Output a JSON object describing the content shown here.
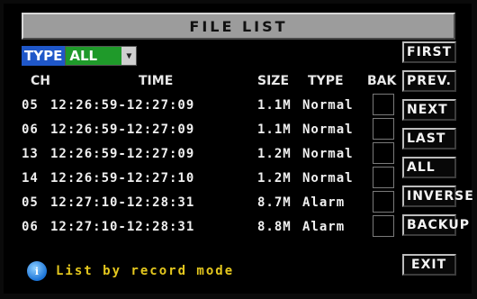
{
  "title": "FILE LIST",
  "type_filter": {
    "label": "TYPE",
    "value": "ALL"
  },
  "table": {
    "headers": {
      "ch": "CH",
      "time": "TIME",
      "size": "SIZE",
      "type": "TYPE",
      "bak": "BAK"
    },
    "rows": [
      {
        "ch": "05",
        "time": "12:26:59-12:27:09",
        "size": "1.1M",
        "type": "Normal",
        "bak": false
      },
      {
        "ch": "06",
        "time": "12:26:59-12:27:09",
        "size": "1.1M",
        "type": "Normal",
        "bak": false
      },
      {
        "ch": "13",
        "time": "12:26:59-12:27:09",
        "size": "1.2M",
        "type": "Normal",
        "bak": false
      },
      {
        "ch": "14",
        "time": "12:26:59-12:27:10",
        "size": "1.2M",
        "type": "Normal",
        "bak": false
      },
      {
        "ch": "05",
        "time": "12:27:10-12:28:31",
        "size": "8.7M",
        "type": "Alarm",
        "bak": false
      },
      {
        "ch": "06",
        "time": "12:27:10-12:28:31",
        "size": "8.8M",
        "type": "Alarm",
        "bak": false
      }
    ]
  },
  "buttons": {
    "first": "FIRST",
    "prev": "PREV.",
    "next": "NEXT",
    "last": "LAST",
    "all": "ALL",
    "inverse": "INVERSE",
    "backup": "BACKUP",
    "exit": "EXIT"
  },
  "status": {
    "icon": "info-icon",
    "text": "List by record mode"
  },
  "colors": {
    "type_label_bg": "#1f57c9",
    "type_value_bg": "#1f9a2a",
    "status_text": "#e5c81e",
    "title_bar": "#9c9c9c"
  }
}
